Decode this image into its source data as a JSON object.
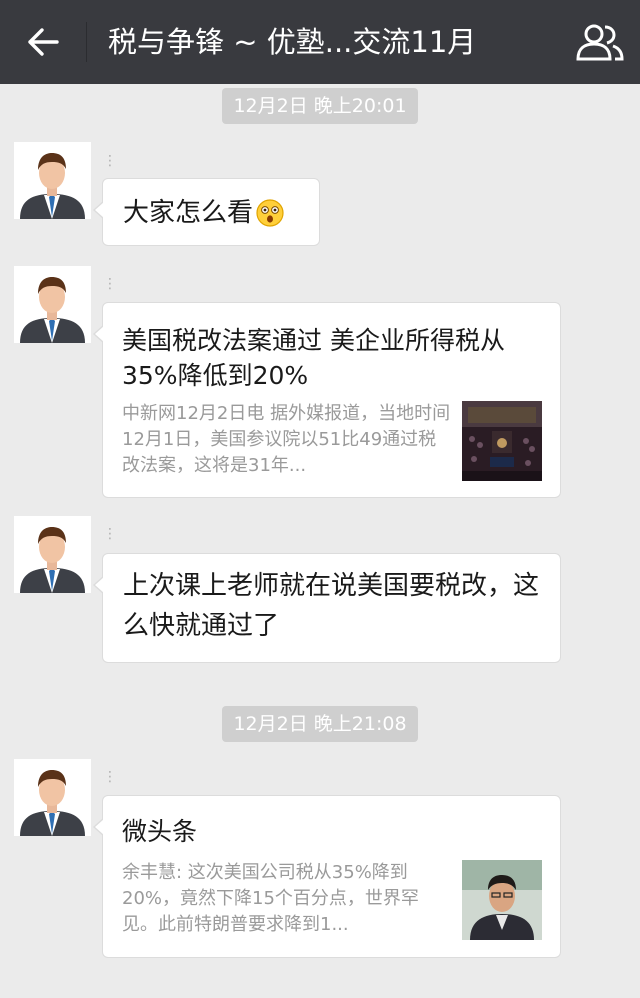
{
  "header": {
    "title": "税与争锋 ~ 优塾...交流11月",
    "back_icon": "back-arrow-icon",
    "contacts_icon": "group-members-icon"
  },
  "timestamps": {
    "t1": "12月2日 晚上20:01",
    "t2": "12月2日 晚上21:08"
  },
  "messages": {
    "m1": {
      "sender": "⋮",
      "text": "大家怎么看"
    },
    "m2": {
      "sender": "⋮",
      "title": "美国税改法案通过 美企业所得税从35%降低到20%",
      "desc": "中新网12月2日电 据外媒报道，当地时间12月1日，美国参议院以51比49通过税改法案，这将是31年..."
    },
    "m3": {
      "sender": "⋮",
      "text": "上次课上老师就在说美国要税改，这么快就通过了"
    },
    "m4": {
      "sender": "⋮",
      "title": "微头条",
      "desc": "余丰慧: 这次美国公司税从35%降到20%，竟然下降15个百分点，世界罕见。此前特朗普要求降到1..."
    }
  },
  "colors": {
    "topbar": "#393a3f",
    "background": "#ebebeb",
    "bubble": "#ffffff",
    "timestamp_pill": "#cfcfcf"
  }
}
